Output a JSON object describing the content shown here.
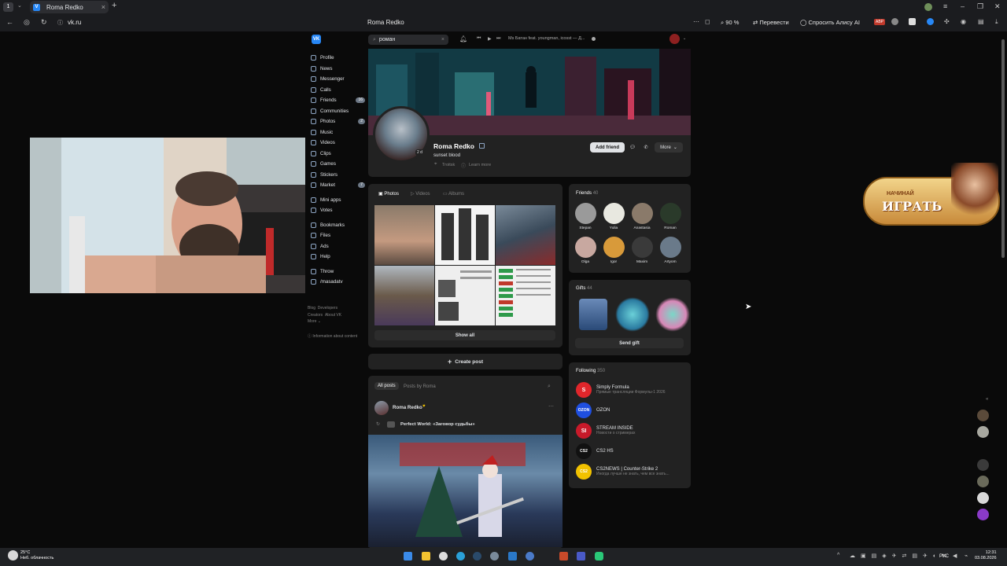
{
  "browser": {
    "tab_title": "Roma Redko",
    "tab_favicon": "V",
    "url": "vk.ru",
    "page_title": "Roma Redko",
    "zoom": "90 %",
    "translate_label": "Перевести",
    "alice_label": "Спросить Алису AI",
    "adblock": "ABP"
  },
  "vk": {
    "logo": "VK",
    "search_value": "роман",
    "player_track": "Ms Батан feat. youngman, icosst — Д..."
  },
  "nav": [
    {
      "label": "Profile",
      "count": ""
    },
    {
      "label": "News",
      "count": ""
    },
    {
      "label": "Messenger",
      "count": ""
    },
    {
      "label": "Calls",
      "count": ""
    },
    {
      "label": "Friends",
      "count": "16"
    },
    {
      "label": "Communities",
      "count": ""
    },
    {
      "label": "Photos",
      "count": "2"
    },
    {
      "label": "Music",
      "count": ""
    },
    {
      "label": "Videos",
      "count": ""
    },
    {
      "label": "Clips",
      "count": ""
    },
    {
      "label": "Games",
      "count": ""
    },
    {
      "label": "Stickers",
      "count": ""
    },
    {
      "label": "Market",
      "count": "7"
    }
  ],
  "nav2": [
    {
      "label": "Mini apps"
    },
    {
      "label": "Votes"
    }
  ],
  "nav3": [
    {
      "label": "Bookmarks"
    },
    {
      "label": "Files"
    },
    {
      "label": "Ads"
    },
    {
      "label": "Help"
    }
  ],
  "nav4": [
    {
      "label": "Throw"
    },
    {
      "label": "/masadatv"
    }
  ],
  "footer": {
    "blog": "Blog",
    "developers": "Developers",
    "creators": "Creators",
    "about": "About VK",
    "more": "More ⌄",
    "info": "Information about content"
  },
  "profile": {
    "name": "Roma Redko",
    "status": "sunset blood",
    "city": "Troitsk",
    "learn_more": "Learn more",
    "age_badge": "2 d",
    "add_friend": "Add friend",
    "more": "More"
  },
  "photos": {
    "tab_photos": "Photos",
    "tab_videos": "Videos",
    "tab_albums": "Albums",
    "show_all": "Show all"
  },
  "create_post": "Create post",
  "wall": {
    "all_posts": "All posts",
    "posts_by": "Posts by Roma",
    "author": "Roma Redko",
    "repost_title": "Perfect World: «Заговор судьбы»"
  },
  "friends": {
    "title": "Friends",
    "count": "40",
    "list": [
      "Stepan",
      "Yulia",
      "Anastasia",
      "Roman",
      "Olga",
      "Igor",
      "Maxim",
      "Artyom"
    ]
  },
  "gifts": {
    "title": "Gifts",
    "count": "44",
    "send": "Send gift"
  },
  "following": {
    "title": "Following",
    "count": "350",
    "list": [
      {
        "name": "Simply Formula",
        "sub": "Прямые трансляции Формулы-1 2026",
        "logo": "S",
        "color": "#e0262b"
      },
      {
        "name": "OZON",
        "sub": "",
        "logo": "OZON",
        "color": "#1f4fe0"
      },
      {
        "name": "STREAM INSIDE",
        "sub": "Новости о стримерах",
        "logo": "SI",
        "color": "#c81a2a"
      },
      {
        "name": "CS2 HS",
        "sub": "",
        "logo": "CS2",
        "color": "#111111"
      },
      {
        "name": "CS2NEWS | Counter-Strike 2",
        "sub": "Иногда лучше не знать, чем все знать...",
        "logo": "CS2",
        "color": "#f2c200"
      }
    ]
  },
  "ad": {
    "top": "НАЧИНАЙ",
    "main": "ИГРАТЬ"
  },
  "taskbar": {
    "weather_temp": "25°C",
    "weather_desc": "Неб. облачность",
    "lang": "РУС",
    "time": "12:31",
    "date": "03.08.2026"
  }
}
